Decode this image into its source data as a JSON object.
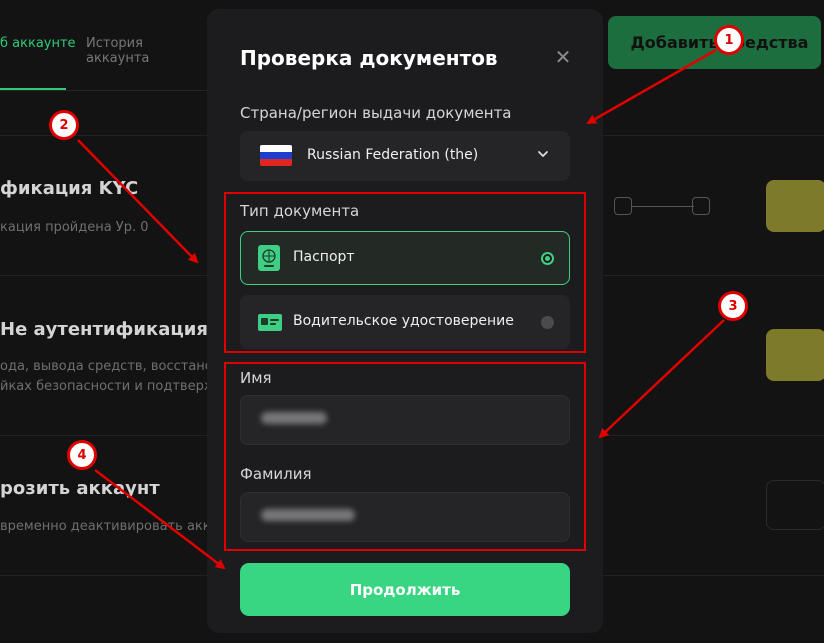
{
  "background": {
    "tabs": {
      "active": "б аккаунте",
      "history": "История аккаунта"
    },
    "add_funds_label": "Добавить средства",
    "kyc": {
      "title": "фикация KYC",
      "subtitle": "кация пройдена Ур. 0"
    },
    "auth": {
      "title": "Не аутентификация",
      "line1": "ода, вывода средств, восстанов",
      "line2": "йках безопасности и подтвержд"
    },
    "freeze": {
      "title": "розить аккаунт",
      "subtitle": "временно деактивировать акка"
    }
  },
  "modal": {
    "title": "Проверка документов",
    "close_icon": "close-icon",
    "country_label": "Страна/регион выдачи документа",
    "country_value": "Russian Federation (the)",
    "country_flag_colors": [
      "#ffffff",
      "#1c3fd1",
      "#e0261f"
    ],
    "doc_type_label": "Тип документа",
    "doc_options": [
      {
        "label": "Паспорт",
        "icon": "passport-icon",
        "selected": true
      },
      {
        "label": "Водительское удостоверение",
        "icon": "driver-license-icon",
        "selected": false
      }
    ],
    "first_name_label": "Имя",
    "last_name_label": "Фамилия",
    "continue_label": "Продолжить"
  },
  "annotations": [
    "1",
    "2",
    "3",
    "4"
  ],
  "colors": {
    "accent": "#38d583",
    "annotation": "#e00000",
    "modal_bg": "#1c1c1e",
    "page_bg": "#131313"
  }
}
